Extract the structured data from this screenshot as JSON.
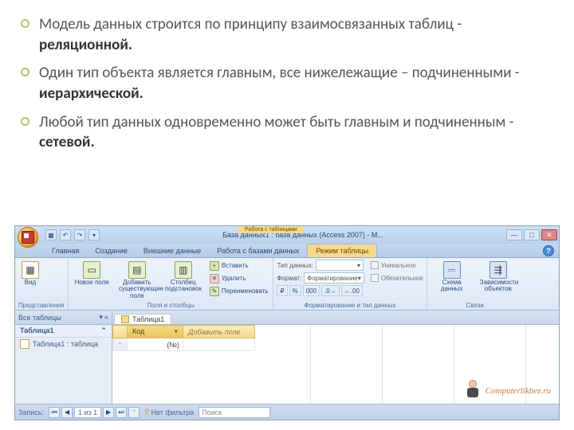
{
  "bullets": [
    {
      "text_pre": "Модель данных строится по принципу взаимосвязанных таблиц - ",
      "bold": "реляционной."
    },
    {
      "text_pre": "Один тип объекта является главным, все нижележащие – подчиненными - ",
      "bold": "иерархической."
    },
    {
      "text_pre": "Любой тип данных одновременно может быть главным и подчиненным -  ",
      "bold": "сетевой."
    }
  ],
  "app": {
    "title": "База данных1 : база данных (Access 2007) - M...",
    "context_title": "Работа с таблицами",
    "tabs": {
      "home": "Главная",
      "create": "Создание",
      "external": "Внешние данные",
      "dbtools": "Работа с базами данных",
      "datasheet": "Режим таблицы"
    },
    "ribbon": {
      "view": "Вид",
      "views_group": "Представления",
      "new_field": "Новое поле",
      "add_existing": "Добавить существующие поля",
      "lookup_col": "Столбец подстановок",
      "insert": "Вставить",
      "delete": "Удалить",
      "rename": "Переименовать",
      "fields_group": "Поля и столбцы",
      "datatype_lbl": "Тип данных:",
      "format_lbl": "Формат:",
      "format_val": "Форматирование",
      "unique_chk": "Уникальное",
      "required_chk": "Обязательное",
      "formatting_group": "Форматирование и тип данных",
      "relationships": "Схема данных",
      "dependencies": "Зависимости объектов",
      "relations_group": "Связи"
    },
    "nav": {
      "header": "Все таблицы",
      "group": "Таблица1",
      "item": "Таблица1 : таблица"
    },
    "doc_tab": "Таблица1",
    "cols": {
      "id": "Код",
      "add": "Добавить поле"
    },
    "new_id": "(№)",
    "status": {
      "record_lbl": "Запись:",
      "pos": "1 из 1",
      "nofilter": "Нет фильтра",
      "search": "Поиск"
    },
    "watermark": "Computerlikbez.ru"
  }
}
